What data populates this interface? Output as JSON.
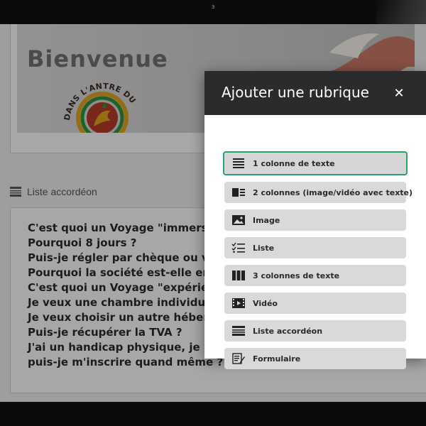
{
  "device": {
    "camera_label": "3"
  },
  "banner": {
    "title": "Bienvenue",
    "emblem_text": "DANS L'ANTRE DU DRAGON"
  },
  "section": {
    "label": "Liste accordéon"
  },
  "faq": {
    "items": [
      "C'est quoi un Voyage \"immersif",
      "Pourquoi 8 jours ?",
      "Puis-je régler par chèque ou vir",
      "Pourquoi la société est-elle en S",
      "C'est quoi un Voyage \"expérien",
      "Je veux une chambre individuel",
      "Je veux choisir un autre héberg",
      "Puis-je récupérer la TVA ?",
      "J'ai un handicap physique, je ne",
      "puis-je m'inscrire quand même ?"
    ]
  },
  "dialog": {
    "title": "Ajouter une rubrique",
    "close_glyph": "✕",
    "options": [
      {
        "label": "1 colonne de texte",
        "icon": "text-lines-icon",
        "selected": true
      },
      {
        "label": "2 colonnes (image/vidéo avec texte)",
        "icon": "image-text-columns-icon",
        "selected": false
      },
      {
        "label": "Image",
        "icon": "image-icon",
        "selected": false
      },
      {
        "label": "Liste",
        "icon": "checklist-icon",
        "selected": false
      },
      {
        "label": "3 colonnes de texte",
        "icon": "three-columns-icon",
        "selected": false
      },
      {
        "label": "Vidéo",
        "icon": "video-icon",
        "selected": false
      },
      {
        "label": "Liste accordéon",
        "icon": "accordion-icon",
        "selected": false
      },
      {
        "label": "Formulaire",
        "icon": "form-icon",
        "selected": false
      }
    ]
  },
  "colors": {
    "dialog_header": "#2b2b2d",
    "option_bg": "#d9d9db",
    "selected_border": "#2aa567",
    "banner_red": "#b23a2a",
    "banner_gold": "#e0a020",
    "banner_green": "#2f8f3a"
  }
}
